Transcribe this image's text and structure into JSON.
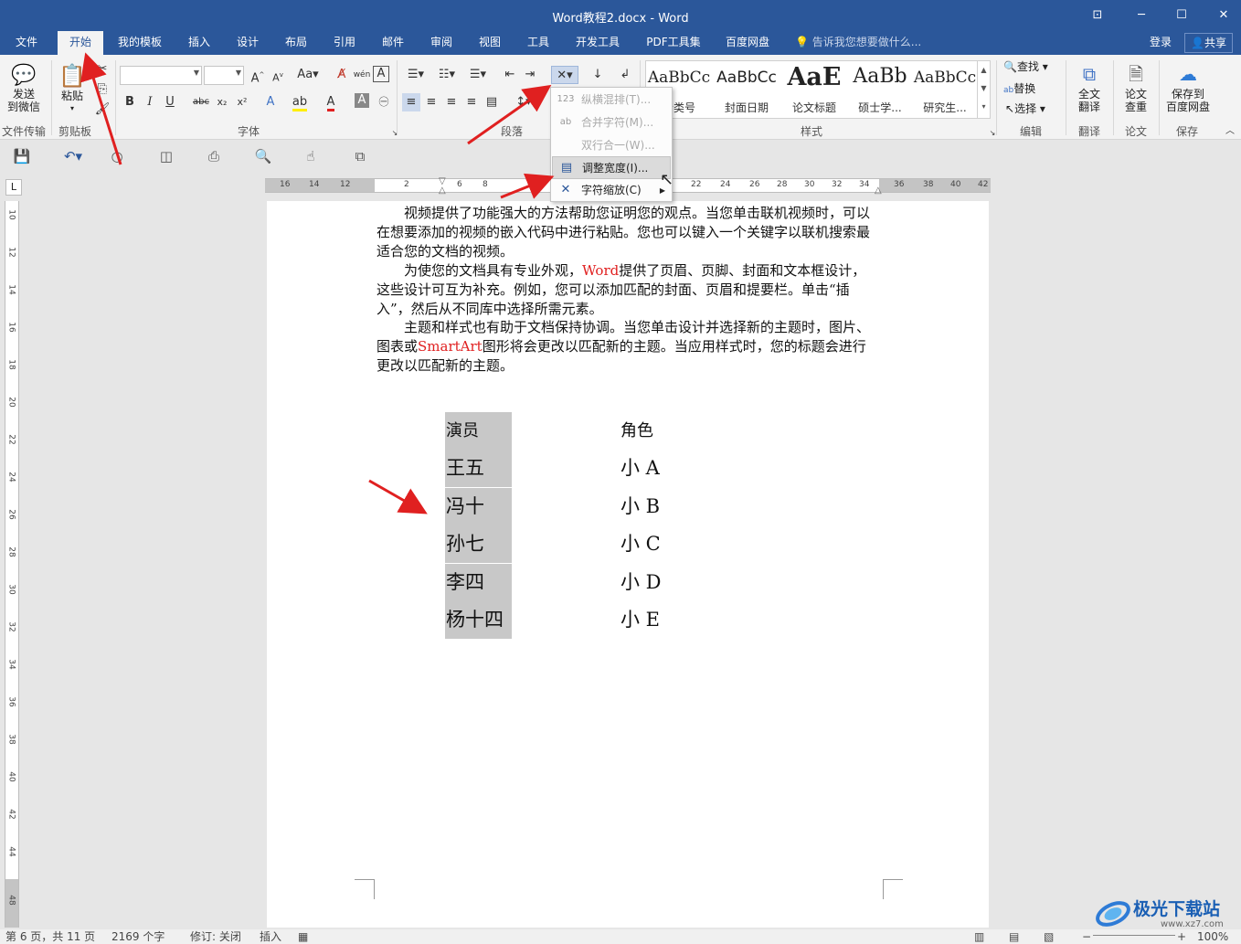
{
  "window": {
    "title": "Word教程2.docx - Word",
    "controls": [
      "restore-ribbon-icon",
      "minimize-icon",
      "maximize-icon",
      "close-icon"
    ]
  },
  "tabs": [
    {
      "label": "文件"
    },
    {
      "label": "开始"
    },
    {
      "label": "我的模板"
    },
    {
      "label": "插入"
    },
    {
      "label": "设计"
    },
    {
      "label": "布局"
    },
    {
      "label": "引用"
    },
    {
      "label": "邮件"
    },
    {
      "label": "审阅"
    },
    {
      "label": "视图"
    },
    {
      "label": "工具"
    },
    {
      "label": "开发工具"
    },
    {
      "label": "PDF工具集"
    },
    {
      "label": "百度网盘"
    }
  ],
  "active_tab": "开始",
  "tell_me": "告诉我您想要做什么...",
  "login": "登录",
  "share": "共享",
  "ribbon": {
    "send_wechat": [
      "发送",
      "到微信"
    ],
    "paste": "粘贴",
    "groups": {
      "file_transfer": "文件传输",
      "clipboard": "剪贴板",
      "font": "字体",
      "paragraph": "段落",
      "styles": "样式",
      "editing": "编辑",
      "translate": "翻译",
      "paper": "论文",
      "save": "保存"
    },
    "font_name": "",
    "font_size": "",
    "aa": "Aa",
    "bold": "B",
    "italic": "I",
    "underline": "U",
    "strike": "abc",
    "sub": "x₂",
    "sup": "x²",
    "styles": [
      {
        "preview": "AaBbCc",
        "name": "分类号"
      },
      {
        "preview": "AaBbCc",
        "name": "封面日期"
      },
      {
        "preview": "AaE",
        "name": "论文标题"
      },
      {
        "preview": "AaBb",
        "name": "硕士学..."
      },
      {
        "preview": "AaBbCc",
        "name": "研究生..."
      }
    ],
    "find": "查找",
    "replace": "替换",
    "select": "选择",
    "full_translate": [
      "全文",
      "翻译"
    ],
    "paper_check": [
      "论文",
      "查重"
    ],
    "save_baidu": [
      "保存到",
      "百度网盘"
    ]
  },
  "dropdown": [
    {
      "icon": "vertical-text-icon",
      "label": "纵横混排(T)...",
      "enabled": false
    },
    {
      "icon": "combine-characters-icon",
      "label": "合并字符(M)...",
      "enabled": false
    },
    {
      "icon": "two-lines-in-one-icon",
      "label": "双行合一(W)...",
      "enabled": false
    },
    {
      "icon": "fit-text-icon",
      "label": "调整宽度(I)...",
      "enabled": true,
      "highlighted": true
    },
    {
      "icon": "character-scale-icon",
      "label": "字符缩放(C)",
      "enabled": true,
      "submenu": true
    }
  ],
  "ruler": {
    "h_numbers": [
      "16",
      "14",
      "12",
      "2",
      "6",
      "8",
      "22",
      "24",
      "26",
      "28",
      "30",
      "32",
      "34",
      "36",
      "38",
      "40",
      "42"
    ],
    "v_numbers": [
      "10",
      "12",
      "14",
      "16",
      "18",
      "20",
      "22",
      "24",
      "26",
      "28",
      "30",
      "32",
      "34",
      "36",
      "38",
      "40",
      "42",
      "44",
      "48"
    ]
  },
  "document": {
    "paragraphs": [
      {
        "text": "视频提供了功能强大的方法帮助您证明您的观点。当您单击联机视频时，可以在想要添加的视频的嵌入代码中进行粘贴。您也可以键入一个关键字以联机搜索最适合您的文档的视频。"
      },
      {
        "before": "为使您的文档具有专业外观，",
        "red": "Word",
        "after": "提供了页眉、页脚、封面和文本框设计，这些设计可互为补充。例如，您可以添加匹配的封面、页眉和提要栏。单击“插入”，然后从不同库中选择所需元素。"
      },
      {
        "before": "主题和样式也有助于文档保持协调。当您单击设计并选择新的主题时，图片、图表或",
        "red": "SmartArt",
        "after": "图形将会更改以匹配新的主题。当应用样式时，您的标题会进行更改以匹配新的主题。"
      }
    ],
    "table": [
      {
        "actor": "演员",
        "role": "角色"
      },
      {
        "actor": "王五",
        "role": "小 A"
      },
      {
        "actor": "冯十",
        "role": "小 B"
      },
      {
        "actor": "孙七",
        "role": "小 C"
      },
      {
        "actor": "李四",
        "role": "小 D"
      },
      {
        "actor": "杨十四",
        "role": "小 E"
      }
    ]
  },
  "status": {
    "page": "第 6 页，共 11 页",
    "words": "2169 个字",
    "track": "修订: 关闭",
    "mode": "插入",
    "zoom": "100%"
  },
  "watermark": {
    "text": "极光下载站",
    "url": "www.xz7.com"
  },
  "colors": {
    "title_blue": "#2b579a",
    "annotation_red": "#e02020",
    "selection_grey": "#c8c8c8"
  }
}
